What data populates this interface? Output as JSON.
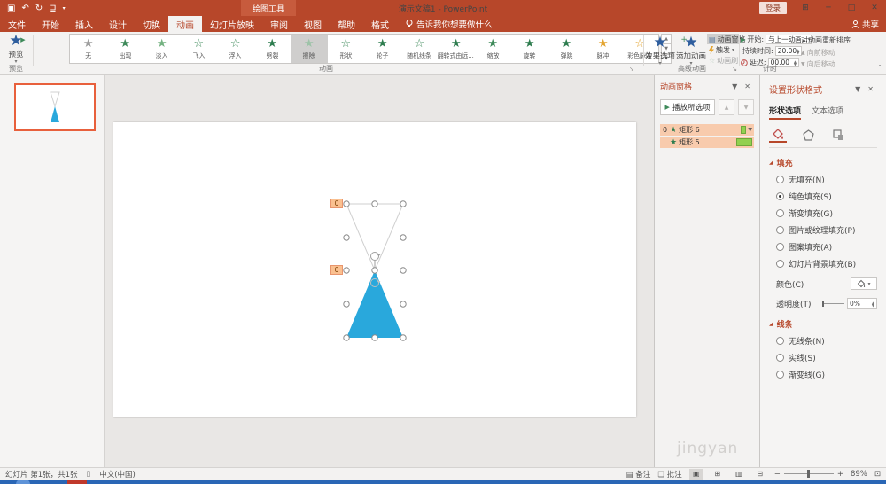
{
  "colors": {
    "theme": "#B7472A",
    "accent_blue": "#2BA6DE",
    "star_green": "#3E8A5A",
    "star_yellow": "#E3A430",
    "pane_item_bg": "#F8CBAD",
    "bar_green": "#92D050",
    "shape_fill_blue": "#29A8DC"
  },
  "titlebar": {
    "title": "演示文稿1 - PowerPoint",
    "contextual_label": "绘图工具",
    "sign_in": "登录",
    "share": "共享"
  },
  "tabs": {
    "items": [
      "文件",
      "开始",
      "插入",
      "设计",
      "切换",
      "动画",
      "幻灯片放映",
      "审阅",
      "视图",
      "帮助",
      "格式"
    ],
    "selected": "动画",
    "tell_me": "告诉我你想要做什么"
  },
  "ribbon": {
    "preview": {
      "label": "预览",
      "group_label": "预览"
    },
    "gallery": {
      "group_label": "动画",
      "items": [
        {
          "label": "无"
        },
        {
          "label": "出现"
        },
        {
          "label": "淡入"
        },
        {
          "label": "飞入"
        },
        {
          "label": "浮入"
        },
        {
          "label": "劈裂"
        },
        {
          "label": "擦除"
        },
        {
          "label": "形状"
        },
        {
          "label": "轮子"
        },
        {
          "label": "随机线条"
        },
        {
          "label": "翻转式由远..."
        },
        {
          "label": "缩放"
        },
        {
          "label": "旋转"
        },
        {
          "label": "弹跳"
        },
        {
          "label": "脉冲"
        },
        {
          "label": "彩色脉冲"
        }
      ],
      "selected": "擦除"
    },
    "advanced": {
      "group_label": "高级动画",
      "effect_options": "效果选项",
      "add_animation": "添加动画",
      "animation_pane": "动画窗格",
      "trigger": "触发",
      "painter": "动画刷"
    },
    "timing": {
      "group_label": "计时",
      "start_label": "开始:",
      "start_value": "与上一动画...",
      "duration_label": "持续时间:",
      "duration_value": "20.00",
      "delay_label": "延迟:",
      "delay_value": "00.00"
    },
    "reorder": {
      "title": "对动画重新排序",
      "earlier": "向前移动",
      "later": "向后移动"
    }
  },
  "animation_pane": {
    "title": "动画窗格",
    "play": "播放所选项",
    "items": [
      {
        "order": "0",
        "name": "矩形 6"
      },
      {
        "order": "",
        "name": "矩形 5"
      }
    ]
  },
  "format_panel": {
    "title": "设置形状格式",
    "tab_shape": "形状选项",
    "tab_text": "文本选项",
    "fill_heading": "填充",
    "fill_options": [
      "无填充(N)",
      "纯色填充(S)",
      "渐变填充(G)",
      "图片或纹理填充(P)",
      "图案填充(A)",
      "幻灯片背景填充(B)"
    ],
    "selected_fill": "纯色填充(S)",
    "color_label": "颜色(C)",
    "transparency_label": "透明度(T)",
    "transparency_value": "0%",
    "line_heading": "线条",
    "line_options": [
      "无线条(N)",
      "实线(S)",
      "渐变线(G)"
    ]
  },
  "statusbar": {
    "slide_info": "幻灯片 第1张，共1张",
    "language": "中文(中国)",
    "notes": "备注",
    "comments": "批注",
    "zoom": "89%"
  },
  "watermark": "jingyan"
}
